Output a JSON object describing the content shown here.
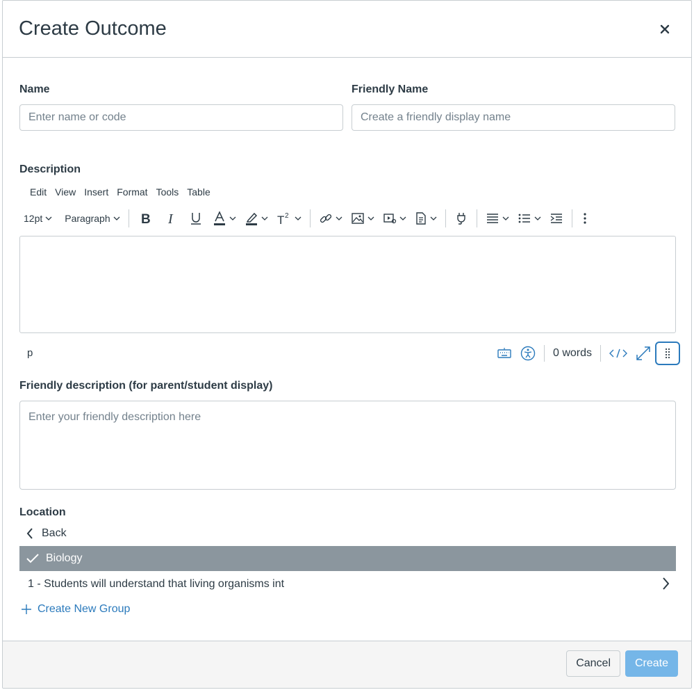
{
  "modal": {
    "title": "Create Outcome",
    "close_icon": "close-icon"
  },
  "form": {
    "name_label": "Name",
    "name_placeholder": "Enter name or code",
    "friendly_name_label": "Friendly Name",
    "friendly_name_placeholder": "Create a friendly display name",
    "description_label": "Description",
    "friendly_description_label": "Friendly description (for parent/student display)",
    "friendly_description_placeholder": "Enter your friendly description here"
  },
  "editor": {
    "menu": [
      "Edit",
      "View",
      "Insert",
      "Format",
      "Tools",
      "Table"
    ],
    "font_size": "12pt",
    "block_format": "Paragraph",
    "path": "p",
    "word_count": "0 words",
    "toolbar_icons": [
      "bold-icon",
      "italic-icon",
      "underline-icon",
      "text-color-icon",
      "highlight-color-icon",
      "superscript-icon",
      "link-icon",
      "image-icon",
      "media-icon",
      "document-icon",
      "plugin-icon",
      "align-icon",
      "list-icon",
      "indent-icon",
      "more-icon"
    ]
  },
  "location": {
    "label": "Location",
    "back": "Back",
    "selected": "Biology",
    "items": [
      "1 - Students will understand that living organisms int"
    ],
    "create_group": "Create New Group"
  },
  "footer": {
    "cancel": "Cancel",
    "create": "Create"
  },
  "colors": {
    "accent": "#2b7abc",
    "selected_row": "#8b969e",
    "create_button": "#75b6e8",
    "text": "#2d3b45",
    "border": "#c7cdd1"
  }
}
